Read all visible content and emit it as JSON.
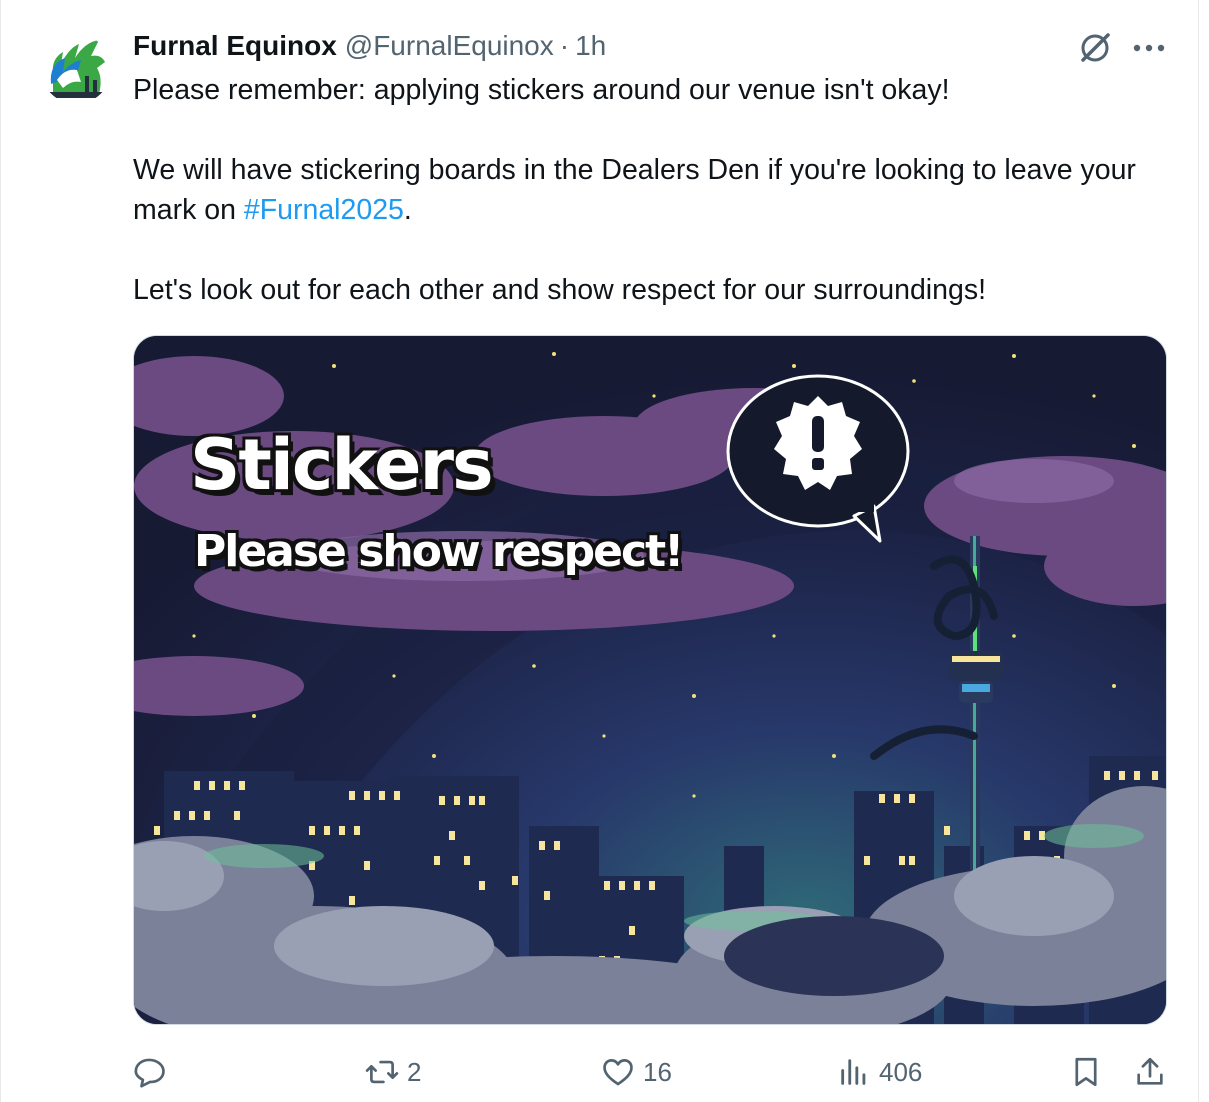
{
  "tweet": {
    "display_name": "Furnal Equinox",
    "handle": "@FurnalEquinox",
    "separator": "·",
    "time": "1h",
    "text_line1": "Please remember: applying stickers around our venue isn't okay!",
    "text_line2_pre": "We will have stickering boards in the Dealers Den if you're looking to leave your mark on ",
    "hashtag": "#Furnal2025",
    "text_line2_post": ".",
    "text_line3": "Let's look out for each other and show respect for our surroundings!"
  },
  "media": {
    "title": "Stickers",
    "subtitle": "Please show respect!"
  },
  "actions": {
    "replies": "",
    "reposts": "2",
    "likes": "16",
    "views": "406"
  },
  "icons": {
    "avatar": "furnal-equinox-logo",
    "grok": "grok-icon",
    "more": "more-icon",
    "reply": "reply-icon",
    "repost": "repost-icon",
    "like": "heart-icon",
    "views": "views-icon",
    "bookmark": "bookmark-icon",
    "share": "share-icon"
  },
  "colors": {
    "text": "#0f1419",
    "muted": "#536471",
    "link": "#1d9bf0"
  }
}
